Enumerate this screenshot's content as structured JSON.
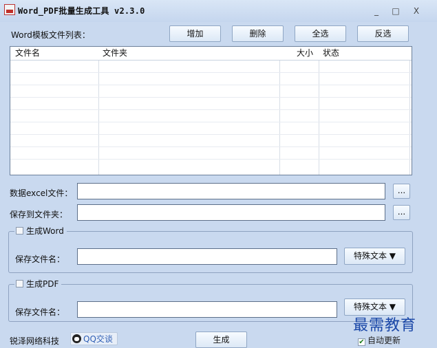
{
  "window": {
    "title": "Word_PDF批量生成工具 v2.3.0",
    "minimize_label": "_",
    "maximize_label": "□",
    "close_label": "X"
  },
  "template_list": {
    "label": "Word模板文件列表：",
    "buttons": {
      "add": "增加",
      "delete": "删除",
      "select_all": "全选",
      "invert": "反选"
    },
    "columns": [
      "文件名",
      "文件夹",
      "大小",
      "状态"
    ]
  },
  "data_file": {
    "label": "数据excel文件：",
    "value": "",
    "browse_label": "..."
  },
  "save_folder": {
    "label": "保存到文件夹：",
    "value": "",
    "browse_label": "..."
  },
  "word_group": {
    "title": "生成Word",
    "checked": false,
    "filename_label": "保存文件名：",
    "filename_value": "",
    "special_text_button": "特殊文本 ▼"
  },
  "pdf_group": {
    "title": "生成PDF",
    "checked": false,
    "filename_label": "保存文件名：",
    "filename_value": "",
    "special_text_button": "特殊文本 ▼"
  },
  "footer": {
    "company": "锐泽网络科技",
    "qq_label": "QQ交谈",
    "generate_button": "生成",
    "auto_update_label": "自动更新",
    "auto_update_checked": true
  },
  "watermark": "最需教育",
  "icons": {
    "app": "word-pdf-app-icon",
    "qq": "qq-penguin-icon"
  }
}
